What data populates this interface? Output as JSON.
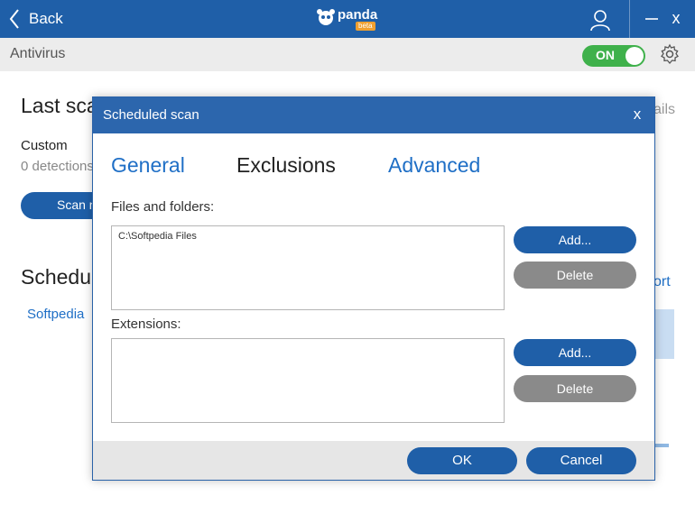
{
  "window": {
    "back_label": "Back",
    "logo_text": "panda",
    "logo_badge": "beta",
    "close_glyph": "x"
  },
  "header": {
    "title": "Antivirus",
    "toggle_label": "ON",
    "toggle_color": "#3fb14b"
  },
  "background": {
    "last_scan_title": "Last sca",
    "scan_type": "Custom",
    "detections": "0 detections",
    "scan_button": "Scan n",
    "scheduled_title": "Schedu",
    "schedule_item": "Softpedia",
    "details_link": "ails",
    "report_link": "ort"
  },
  "dialog": {
    "title": "Scheduled scan",
    "close_glyph": "x",
    "tabs": [
      {
        "label": "General"
      },
      {
        "label": "Exclusions"
      },
      {
        "label": "Advanced"
      }
    ],
    "files_label": "Files and folders:",
    "files_entries": [
      "C:\\Softpedia Files"
    ],
    "files_add": "Add...",
    "files_delete": "Delete",
    "extensions_label": "Extensions:",
    "extensions_add": "Add...",
    "extensions_delete": "Delete",
    "ok_label": "OK",
    "cancel_label": "Cancel"
  },
  "colors": {
    "brand_blue": "#1f5fa8",
    "link_blue": "#1f6fc6",
    "disabled_gray": "#8a8a8a"
  },
  "icons": [
    "chevron-left-icon",
    "panda-logo-icon",
    "user-icon",
    "minimize-icon",
    "close-icon",
    "gear-icon"
  ]
}
